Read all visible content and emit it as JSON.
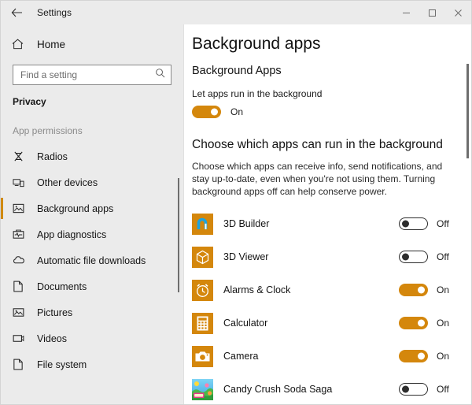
{
  "window": {
    "title": "Settings",
    "back_icon": "back-arrow-icon",
    "minimize_label": "Minimize",
    "maximize_label": "Maximize",
    "close_label": "Close"
  },
  "sidebar": {
    "home_label": "Home",
    "home_icon": "home-icon",
    "search": {
      "placeholder": "Find a setting",
      "value": "",
      "icon": "search-icon"
    },
    "category": "Privacy",
    "group_label": "App permissions",
    "items": [
      {
        "label": "Radios",
        "icon": "radio-tower-icon",
        "selected": false
      },
      {
        "label": "Other devices",
        "icon": "devices-icon",
        "selected": false
      },
      {
        "label": "Background apps",
        "icon": "picture-frame-icon",
        "selected": true
      },
      {
        "label": "App diagnostics",
        "icon": "diagnostics-icon",
        "selected": false
      },
      {
        "label": "Automatic file downloads",
        "icon": "cloud-icon",
        "selected": false
      },
      {
        "label": "Documents",
        "icon": "document-icon",
        "selected": false
      },
      {
        "label": "Pictures",
        "icon": "picture-icon",
        "selected": false
      },
      {
        "label": "Videos",
        "icon": "video-icon",
        "selected": false
      },
      {
        "label": "File system",
        "icon": "document-icon",
        "selected": false
      }
    ]
  },
  "main": {
    "page_title": "Background apps",
    "section_heading": "Background Apps",
    "master_toggle": {
      "label": "Let apps run in the background",
      "state": "On",
      "on": true
    },
    "choose_heading": "Choose which apps can run in the background",
    "description": "Choose which apps can receive info, send notifications, and stay up-to-date, even when you're not using them. Turning background apps off can help conserve power.",
    "apps": [
      {
        "name": "3D Builder",
        "state": "Off",
        "on": false,
        "icon": "3d-builder-app-icon"
      },
      {
        "name": "3D Viewer",
        "state": "Off",
        "on": false,
        "icon": "3d-viewer-app-icon"
      },
      {
        "name": "Alarms & Clock",
        "state": "On",
        "on": true,
        "icon": "alarms-clock-app-icon"
      },
      {
        "name": "Calculator",
        "state": "On",
        "on": true,
        "icon": "calculator-app-icon"
      },
      {
        "name": "Camera",
        "state": "On",
        "on": true,
        "icon": "camera-app-icon"
      },
      {
        "name": "Candy Crush Soda Saga",
        "state": "Off",
        "on": false,
        "icon": "candy-crush-app-icon"
      }
    ]
  },
  "colors": {
    "accent": "#d4870c",
    "sidebar_bg": "#ebebeb",
    "content_bg": "#ffffff",
    "selection_bar": "#d08a11",
    "app_tile": "#d4870c"
  }
}
